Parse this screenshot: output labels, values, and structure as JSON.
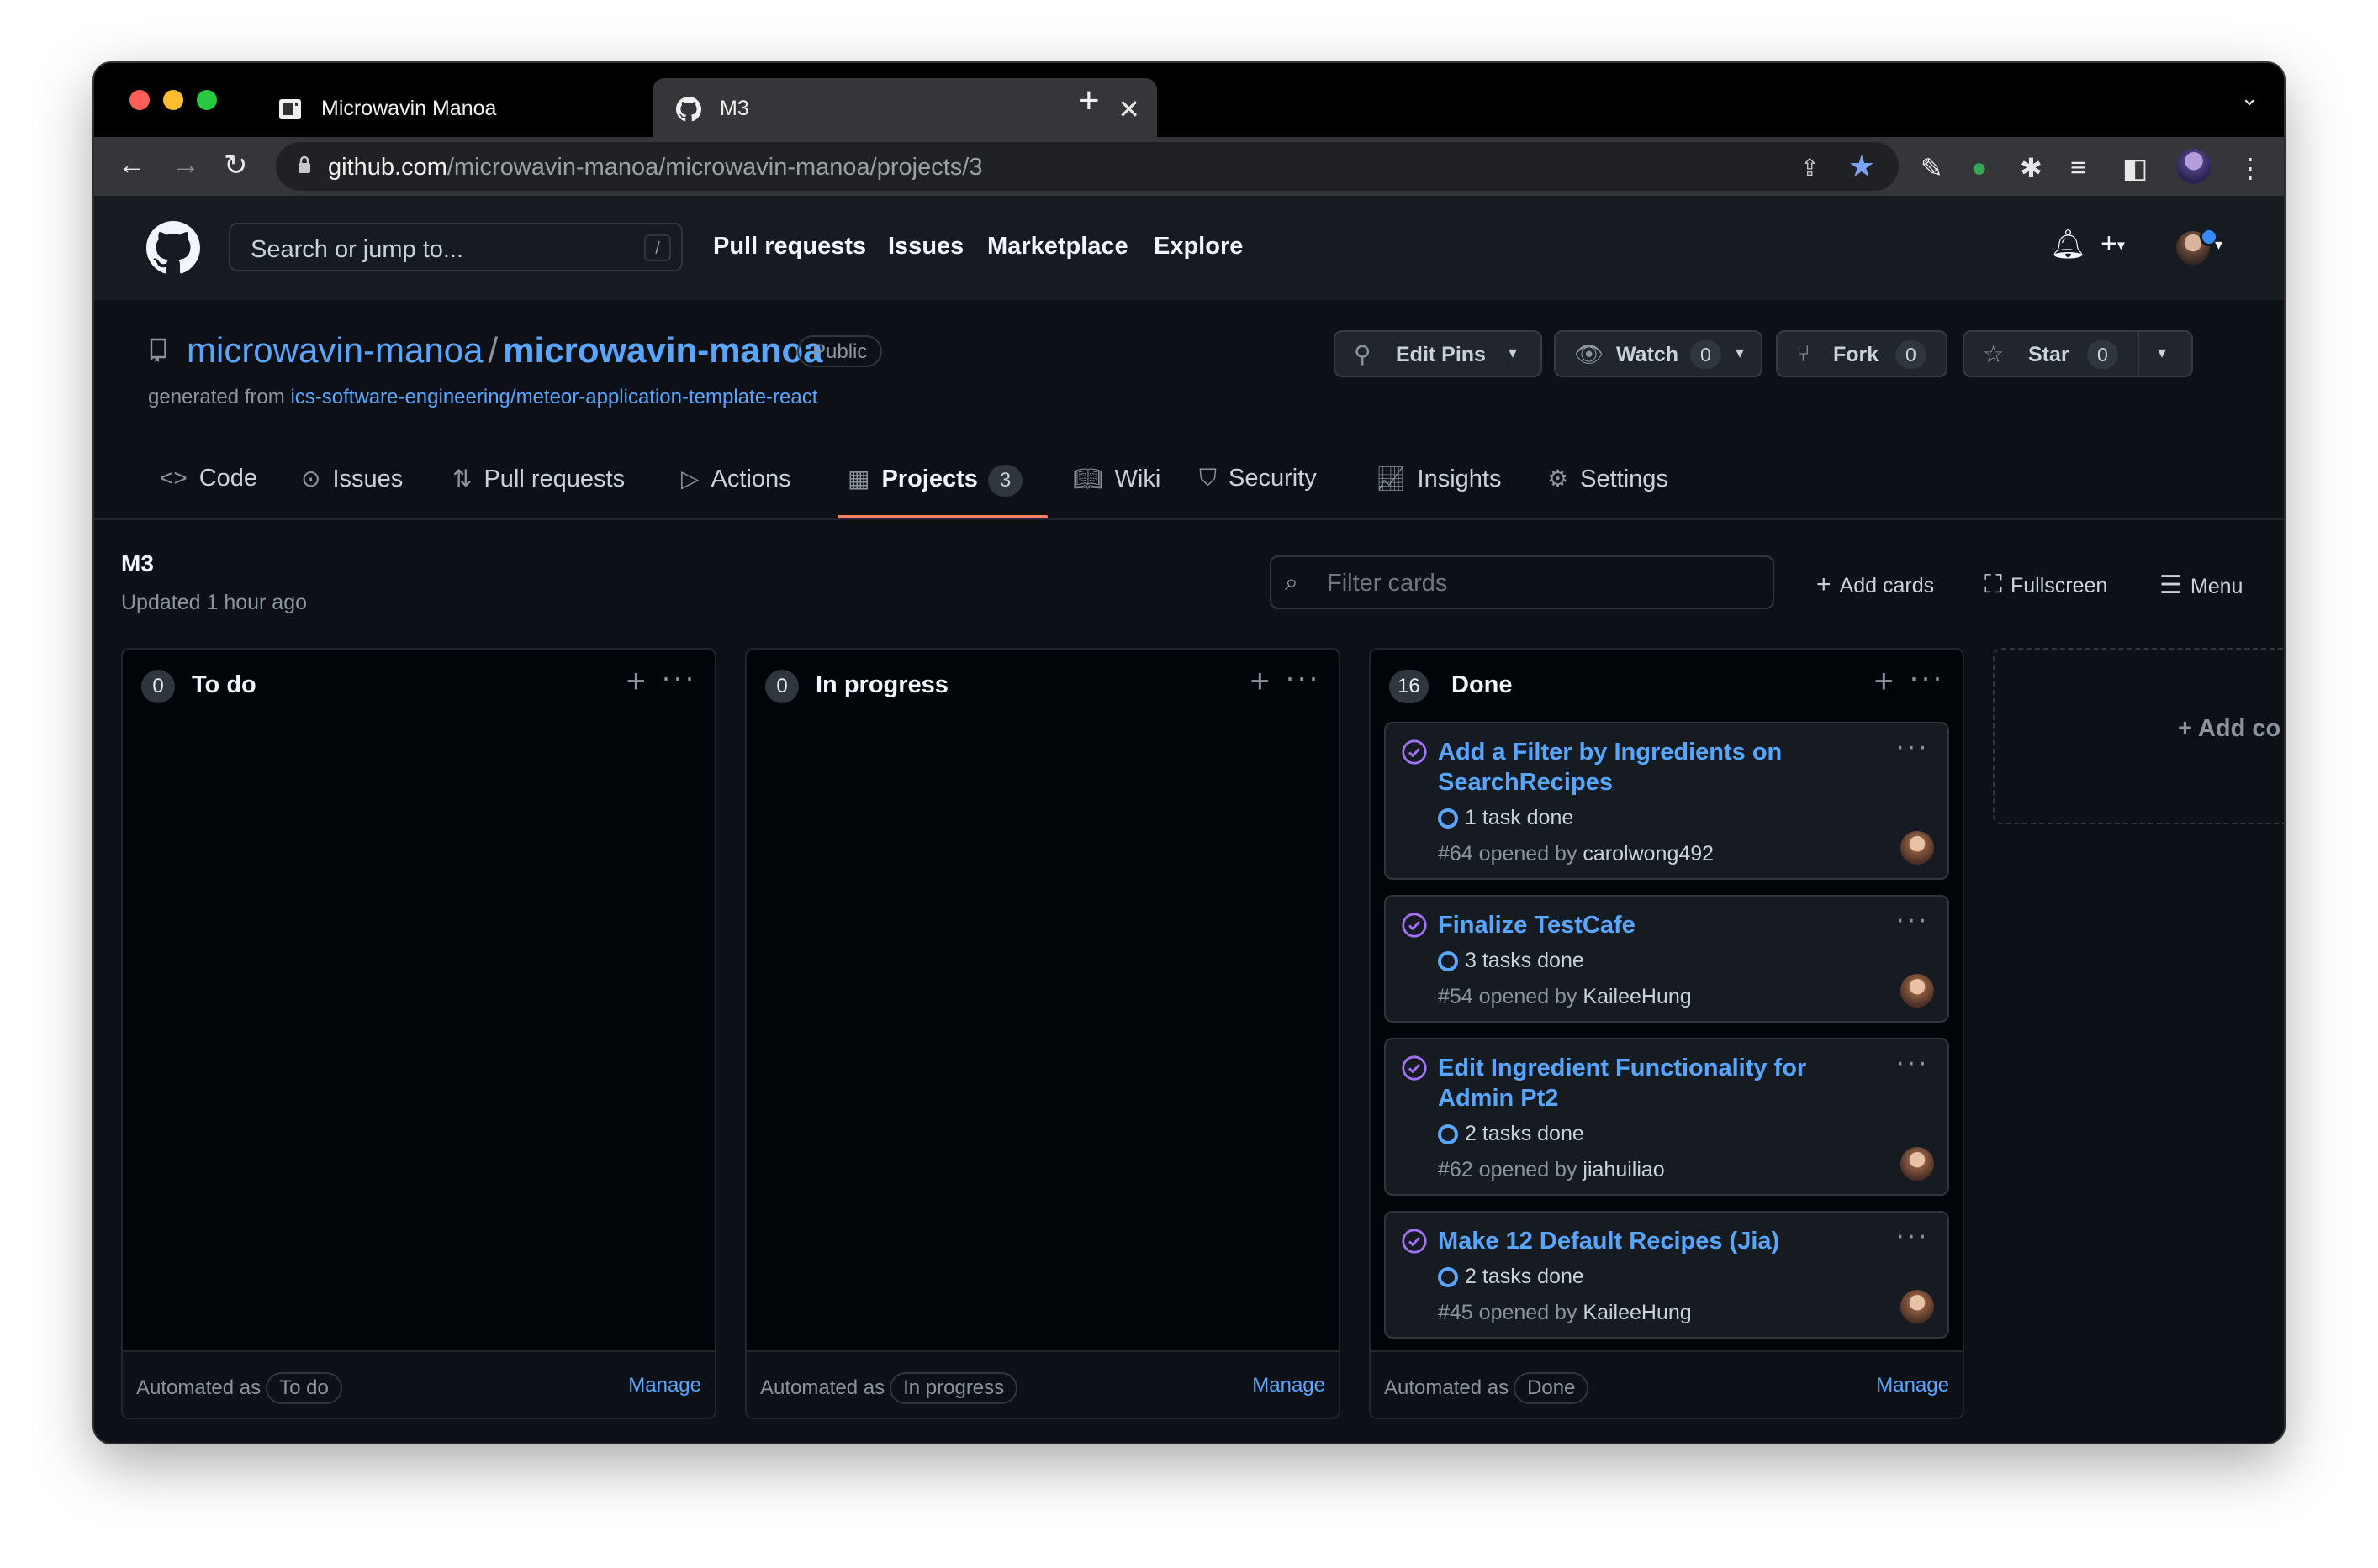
{
  "browser": {
    "tabs": [
      {
        "title": "Microwavin Manoa",
        "close": "✕"
      },
      {
        "title": "M3",
        "close": "✕"
      }
    ],
    "new_tab": "+",
    "url_host": "github.com",
    "url_path": "/microwavin-manoa/microwavin-manoa/projects/3"
  },
  "header": {
    "search_placeholder": "Search or jump to...",
    "search_key": "/",
    "nav": [
      "Pull requests",
      "Issues",
      "Marketplace",
      "Explore"
    ]
  },
  "repo": {
    "owner": "microwavin-manoa",
    "separator": "/",
    "name": "microwavin-manoa",
    "visibility": "Public",
    "generated_prefix": "generated from",
    "generated_link": "ics-software-engineering/meteor-application-template-react",
    "buttons": {
      "edit_pins": "Edit Pins",
      "watch": "Watch",
      "watch_count": "0",
      "fork": "Fork",
      "fork_count": "0",
      "star": "Star",
      "star_count": "0"
    },
    "tabs": {
      "code": "Code",
      "issues": "Issues",
      "pull_requests": "Pull requests",
      "actions": "Actions",
      "projects": "Projects",
      "projects_count": "3",
      "wiki": "Wiki",
      "security": "Security",
      "insights": "Insights",
      "settings": "Settings"
    }
  },
  "project": {
    "title": "M3",
    "updated": "Updated 1 hour ago",
    "filter_placeholder": "Filter cards",
    "add_cards": "Add cards",
    "fullscreen": "Fullscreen",
    "menu": "Menu",
    "add_column": "+ Add co"
  },
  "columns": [
    {
      "count": "0",
      "name": "To do",
      "automated_label": "Automated as",
      "automated_value": "To do",
      "manage": "Manage",
      "cards": []
    },
    {
      "count": "0",
      "name": "In progress",
      "automated_label": "Automated as",
      "automated_value": "In progress",
      "manage": "Manage",
      "cards": []
    },
    {
      "count": "16",
      "name": "Done",
      "automated_label": "Automated as",
      "automated_value": "Done",
      "manage": "Manage",
      "cards": [
        {
          "title": "Add a Filter by Ingredients on SearchRecipes",
          "tasks": "1 task done",
          "number": "#64",
          "opened_by": "opened by",
          "author": "carolwong492"
        },
        {
          "title": "Finalize TestCafe",
          "tasks": "3 tasks done",
          "number": "#54",
          "opened_by": "opened by",
          "author": "KaileeHung"
        },
        {
          "title": "Edit Ingredient Functionality for Admin Pt2",
          "tasks": "2 tasks done",
          "number": "#62",
          "opened_by": "opened by",
          "author": "jiahuiliao"
        },
        {
          "title": "Make 12 Default Recipes (Jia)",
          "tasks": "2 tasks done",
          "number": "#45",
          "opened_by": "opened by",
          "author": "KaileeHung"
        }
      ]
    }
  ],
  "colors": {
    "accent": "#58a6ff",
    "tab_underline": "#f78166",
    "done_icon": "#a371f7"
  }
}
